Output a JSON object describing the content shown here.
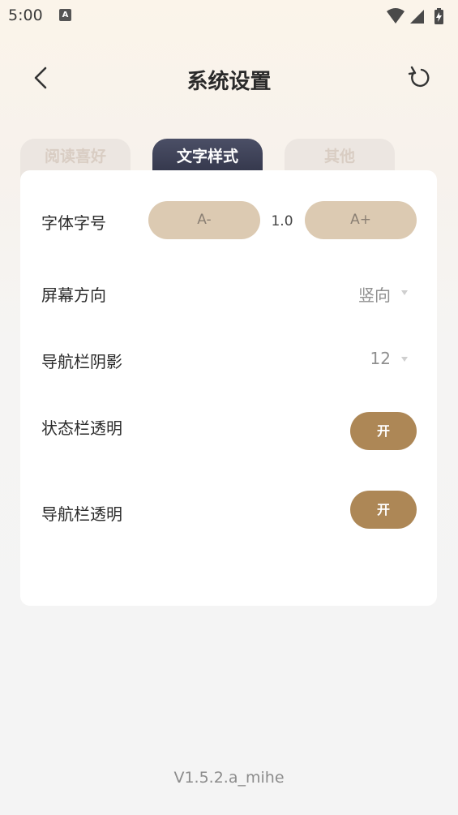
{
  "status_bar": {
    "time": "5:00",
    "notification_glyph": "A",
    "icons": [
      "wifi-icon",
      "signal-icon",
      "battery-charging-icon"
    ]
  },
  "header": {
    "title": "系统设置",
    "back_icon": "chevron-left-icon",
    "reset_icon": "refresh-icon"
  },
  "tabs": [
    {
      "label": "阅读喜好",
      "active": false
    },
    {
      "label": "文字样式",
      "active": true
    },
    {
      "label": "其他",
      "active": false
    }
  ],
  "settings": {
    "font_size": {
      "label": "字体字号",
      "decrease_label": "A-",
      "value": "1.0",
      "increase_label": "A+"
    },
    "screen_orientation": {
      "label": "屏幕方向",
      "value": "竖向"
    },
    "nav_shadow": {
      "label": "导航栏阴影",
      "value": "12"
    },
    "statusbar_transparent": {
      "label": "状态栏透明",
      "toggle_label": "开"
    },
    "navbar_transparent": {
      "label": "导航栏透明",
      "toggle_label": "开"
    }
  },
  "version": "V1.5.2.a_mihe",
  "colors": {
    "accent": "#ad8756",
    "pill": "#dccab2",
    "active_tab": "#3a3d52"
  }
}
